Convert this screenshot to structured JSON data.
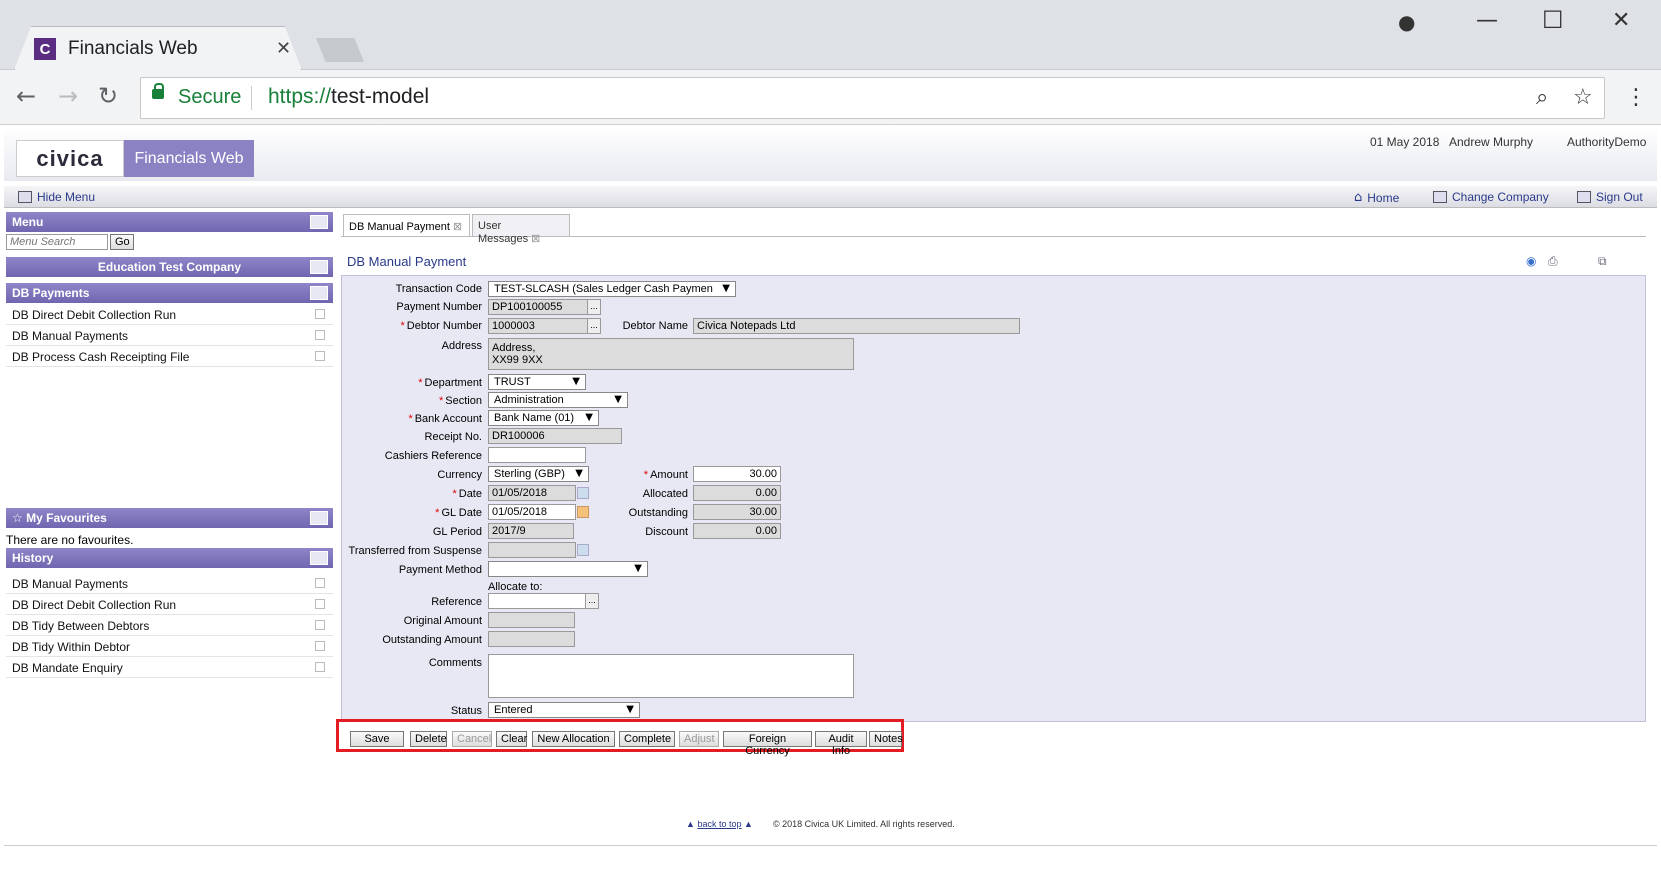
{
  "browser": {
    "tab_title": "Financials Web",
    "tab_favicon_letter": "C",
    "secure_label": "Secure",
    "url_protocol": "https://",
    "url_host": "test-model"
  },
  "app": {
    "logo_text": "civica",
    "product_name": "Financials Web",
    "date": "01 May 2018",
    "user": "Andrew Murphy",
    "authority": "AuthorityDemo",
    "hide_menu": "Hide Menu",
    "home": "Home",
    "change_company": "Change Company",
    "sign_out": "Sign Out"
  },
  "sidebar": {
    "menu_title": "Menu",
    "search_placeholder": "Menu Search",
    "go_label": "Go",
    "company": "Education Test Company",
    "section_title": "DB Payments",
    "items": [
      {
        "label": "DB Direct Debit Collection Run"
      },
      {
        "label": "DB Manual Payments"
      },
      {
        "label": "DB Process Cash Receipting File"
      }
    ],
    "favourites_title": "My Favourites",
    "favourites_empty": "There are no favourites.",
    "history_title": "History",
    "history": [
      {
        "label": "DB Manual Payments"
      },
      {
        "label": "DB Direct Debit Collection Run"
      },
      {
        "label": "DB Tidy Between Debtors"
      },
      {
        "label": "DB Tidy Within Debtor"
      },
      {
        "label": "DB Mandate Enquiry"
      }
    ]
  },
  "tabs": [
    {
      "label": "DB Manual Payment",
      "active": true
    },
    {
      "label": "User Messages",
      "active": false
    }
  ],
  "form": {
    "title": "DB Manual Payment",
    "transaction_code_label": "Transaction Code",
    "transaction_code": "TEST-SLCASH (Sales Ledger Cash Paymen",
    "payment_number_label": "Payment Number",
    "payment_number": "DP100100055",
    "debtor_number_label": "Debtor Number",
    "debtor_number": "1000003",
    "debtor_name_label": "Debtor Name",
    "debtor_name": "Civica Notepads Ltd",
    "address_label": "Address",
    "address_line1": "Address,",
    "address_line2": "XX99 9XX",
    "department_label": "Department",
    "department": "TRUST",
    "section_label": "Section",
    "section": "Administration",
    "bank_account_label": "Bank Account",
    "bank_account": "Bank Name (01)",
    "receipt_no_label": "Receipt No.",
    "receipt_no": "DR100006",
    "cashiers_reference_label": "Cashiers Reference",
    "cashiers_reference": "",
    "currency_label": "Currency",
    "currency": "Sterling (GBP)",
    "amount_label": "Amount",
    "amount": "30.00",
    "date_label": "Date",
    "date": "01/05/2018",
    "allocated_label": "Allocated",
    "allocated": "0.00",
    "gl_date_label": "GL Date",
    "gl_date": "01/05/2018",
    "outstanding_label": "Outstanding",
    "outstanding": "30.00",
    "gl_period_label": "GL Period",
    "gl_period": "2017/9",
    "discount_label": "Discount",
    "discount": "0.00",
    "transferred_label": "Transferred from Suspense",
    "transferred": "",
    "payment_method_label": "Payment Method",
    "payment_method": "",
    "allocate_to_label": "Allocate to:",
    "reference_label": "Reference",
    "reference": "",
    "original_amount_label": "Original Amount",
    "original_amount": "",
    "outstanding_amount_label": "Outstanding Amount",
    "outstanding_amount": "",
    "comments_label": "Comments",
    "comments": "",
    "status_label": "Status",
    "status": "Entered"
  },
  "buttons": {
    "save": "Save",
    "delete": "Delete",
    "cancel": "Cancel",
    "clear": "Clear",
    "new_allocation": "New Allocation",
    "complete": "Complete",
    "adjust": "Adjust",
    "foreign_currency": "Foreign Currency",
    "audit_info": "Audit Info",
    "notes": "Notes"
  },
  "footer": {
    "back_to_top": "back to top",
    "copyright": "© 2018 Civica UK Limited. All rights reserved."
  },
  "colors": {
    "accent": "#6f66b0",
    "highlight": "#e31b23",
    "link": "#2a3a8a"
  }
}
